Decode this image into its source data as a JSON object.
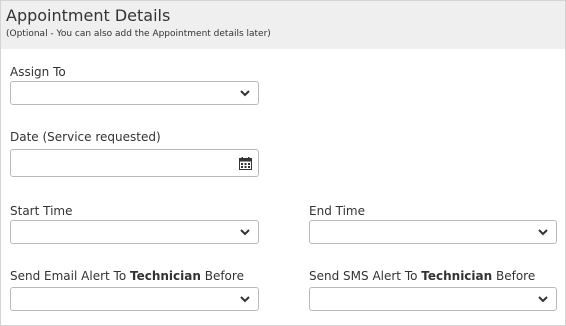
{
  "header": {
    "title": "Appointment Details",
    "subtitle": "(Optional - You can also add the Appointment details later)"
  },
  "fields": {
    "assign_to": {
      "label": "Assign To",
      "value": ""
    },
    "date": {
      "label": "Date (Service requested)",
      "value": ""
    },
    "start_time": {
      "label": "Start Time",
      "value": ""
    },
    "end_time": {
      "label": "End Time",
      "value": ""
    },
    "email_alert": {
      "label_prefix": "Send Email Alert To ",
      "label_bold": "Technician",
      "label_suffix": " Before",
      "value": ""
    },
    "sms_alert": {
      "label_prefix": "Send SMS Alert To ",
      "label_bold": "Technician",
      "label_suffix": " Before",
      "value": ""
    }
  },
  "icons": {
    "dropdown": "chevron-down-icon",
    "date_picker": "calendar-icon"
  },
  "colors": {
    "header_bg": "#efefef",
    "border": "#b9b9b9",
    "text": "#333333"
  }
}
